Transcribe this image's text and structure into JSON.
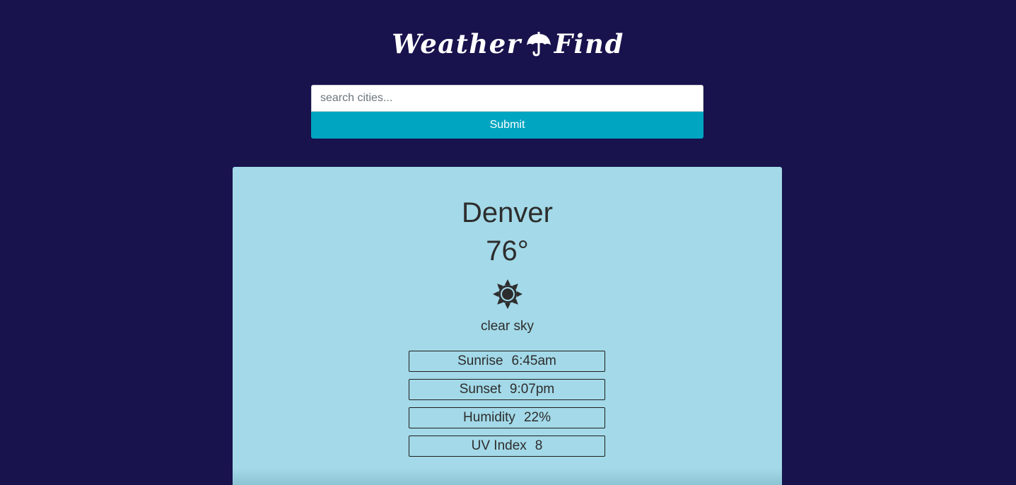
{
  "header": {
    "logo_left": "Weather",
    "logo_right": "Find",
    "logo_icon": "umbrella-icon"
  },
  "search": {
    "placeholder": "search cities...",
    "value": "",
    "submit_label": "Submit"
  },
  "weather": {
    "city": "Denver",
    "temperature": "76°",
    "icon": "sun-icon",
    "description": "clear sky",
    "stats": [
      {
        "label": "Sunrise",
        "value": "6:45am"
      },
      {
        "label": "Sunset",
        "value": "9:07pm"
      },
      {
        "label": "Humidity",
        "value": "22%"
      },
      {
        "label": "UV Index",
        "value": "8"
      }
    ]
  },
  "colors": {
    "background": "#18124d",
    "button": "#00a5c1",
    "card": "#a3d9e8",
    "text": "#2d2d2d"
  }
}
